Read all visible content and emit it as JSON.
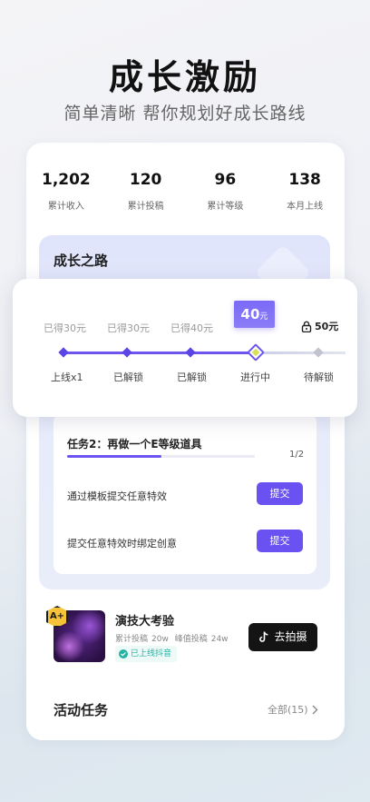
{
  "hero": {
    "title": "成长激励",
    "subtitle": "简单清晰 帮你规划好成长路线"
  },
  "stats": [
    {
      "value": "1,202",
      "label": "累计收入"
    },
    {
      "value": "120",
      "label": "累计投稿"
    },
    {
      "value": "96",
      "label": "累计等级"
    },
    {
      "value": "138",
      "label": "本月上线"
    }
  ],
  "growth": {
    "title": "成长之路",
    "earned": [
      "已得30元",
      "已得30元",
      "已得40元"
    ],
    "current_reward": {
      "amount": "40",
      "unit": "元"
    },
    "locked_reward": "50元",
    "stages": [
      "上线x1",
      "已解锁",
      "已解锁",
      "进行中",
      "待解锁"
    ]
  },
  "task": {
    "title": "任务2：再做一个E等级道具",
    "progress": 0.5,
    "count": "1/2",
    "rows": [
      {
        "label": "通过模板提交任意特效",
        "button": "提交"
      },
      {
        "label": "提交任意特效时绑定创意",
        "button": "提交"
      }
    ]
  },
  "challenge": {
    "badge": "A+",
    "title": "演技大考验",
    "meta": [
      "累计投稿",
      "20w",
      "峰值投稿",
      "24w"
    ],
    "tag": "已上线抖音",
    "button": "去拍摄"
  },
  "activity": {
    "title": "活动任务",
    "all_label": "全部(15)"
  },
  "colors": {
    "accent": "#6a51f1",
    "tag_green": "#25b3a4",
    "badge_gold": "#f6c338"
  }
}
